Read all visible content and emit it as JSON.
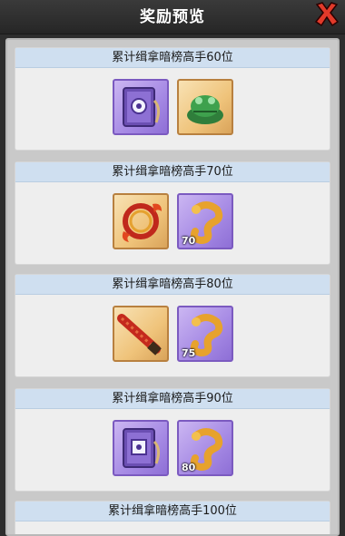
{
  "dialog": {
    "title": "奖励预览"
  },
  "rewards": [
    {
      "label": "累计缉拿暗榜高手60位",
      "items": [
        {
          "icon": "purple-box-icon",
          "count": ""
        },
        {
          "icon": "jade-toad-icon",
          "count": ""
        }
      ]
    },
    {
      "label": "累计缉拿暗榜高手70位",
      "items": [
        {
          "icon": "flame-ring-icon",
          "count": ""
        },
        {
          "icon": "gold-coil-icon",
          "count": "70"
        }
      ]
    },
    {
      "label": "累计缉拿暗榜高手80位",
      "items": [
        {
          "icon": "red-scroll-icon",
          "count": ""
        },
        {
          "icon": "gold-coil-icon",
          "count": "75"
        }
      ]
    },
    {
      "label": "累计缉拿暗榜高手90位",
      "items": [
        {
          "icon": "purple-box-icon",
          "count": ""
        },
        {
          "icon": "gold-coil-icon",
          "count": "80"
        }
      ]
    },
    {
      "label": "累计缉拿暗榜高手100位",
      "items": []
    }
  ],
  "colors": {
    "rare_purple": "#a589e4",
    "rare_orange": "#efc37a",
    "header_blue": "#cfdff0",
    "close_red": "#e23a2a"
  }
}
